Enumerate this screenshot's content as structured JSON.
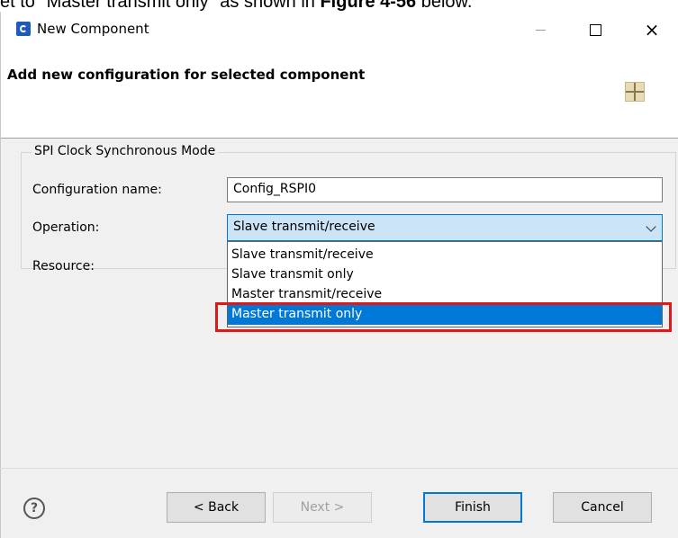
{
  "caption": {
    "prefix": "et to \"Master transmit only\" as shown in ",
    "figure": "Figure 4-56",
    "suffix": " below."
  },
  "window": {
    "title": "New Component"
  },
  "header": {
    "title": "Add new configuration for selected component"
  },
  "group": {
    "legend": "SPI Clock Synchronous Mode"
  },
  "fields": {
    "config_name_label": "Configuration name:",
    "config_name_value": "Config_RSPI0",
    "operation_label": "Operation:",
    "operation_value": "Slave transmit/receive",
    "resource_label": "Resource:"
  },
  "operation_options": [
    "Slave transmit/receive",
    "Slave transmit only",
    "Master transmit/receive",
    "Master transmit only"
  ],
  "highlighted_option_index": 3,
  "buttons": {
    "back": "< Back",
    "next": "Next >",
    "finish": "Finish",
    "cancel": "Cancel"
  },
  "icons": {
    "help": "?",
    "close": "×"
  },
  "colors": {
    "selection": "#0078d7",
    "highlight_box": "#e01818",
    "select_bg": "#cce4f7"
  }
}
